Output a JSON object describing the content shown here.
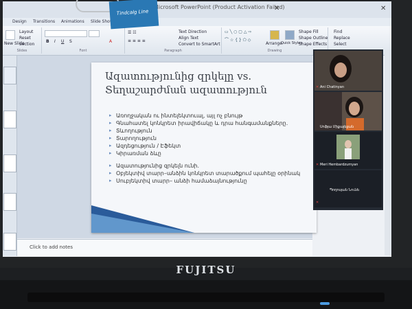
{
  "window": {
    "title": "Microsoft PowerPoint (Product Activation Failed)"
  },
  "ribbon": {
    "tabs": [
      "Design",
      "Transitions",
      "Animations",
      "Slide Show"
    ],
    "slides_group": {
      "new_slide": "New Slide",
      "layout": "Layout",
      "reset": "Reset",
      "section": "Section",
      "label": "Slides"
    },
    "font_group": {
      "label": "Font"
    },
    "paragraph_group": {
      "text_direction": "Text Direction",
      "align_text": "Align Text",
      "convert_smartart": "Convert to SmartArt",
      "label": "Paragraph"
    },
    "drawing_group": {
      "arrange": "Arrange",
      "quick_styles": "Quick Styles",
      "shape_fill": "Shape Fill",
      "shape_outline": "Shape Outline",
      "shape_effects": "Shape Effects",
      "label": "Drawing"
    },
    "editing_group": {
      "find": "Find",
      "replace": "Replace",
      "select": "Select"
    }
  },
  "slide": {
    "title_line1": "Ազատությունից զրկելը vs.",
    "title_line2": "Տեղաշարժման ազատություն",
    "bullets": [
      "Առողջական ու ինտելեկտուալ, այլ ոչ բնույթ",
      "Գնահատել կոնկրետ իրավիճակը և դրա հանգամանքները.",
      "Տևողություն",
      "Տարողություն",
      "Ազդեցություն / Էֆեկտ",
      "Կիրառման ձևը",
      "Ազատությունից զրկելն ունի.",
      "Օբյեկտիվ տարր–անձին կոնկրետ տարածքում պահելը օրինակ",
      "Սուբյեկտիվ տարր– անձի համաձայնությունը"
    ]
  },
  "notes": {
    "placeholder": "Click to add notes"
  },
  "video": {
    "participants": [
      {
        "name": "Ani Chatinyan"
      },
      {
        "name": "Սոֆյա Միքայելյան"
      },
      {
        "name": "Meri Hembardzumyan"
      },
      {
        "name": "Պողոսյան Նունե"
      }
    ]
  },
  "sticker": {
    "text": "Tindcalg Line"
  },
  "laptop": {
    "brand": "FUJITSU"
  }
}
